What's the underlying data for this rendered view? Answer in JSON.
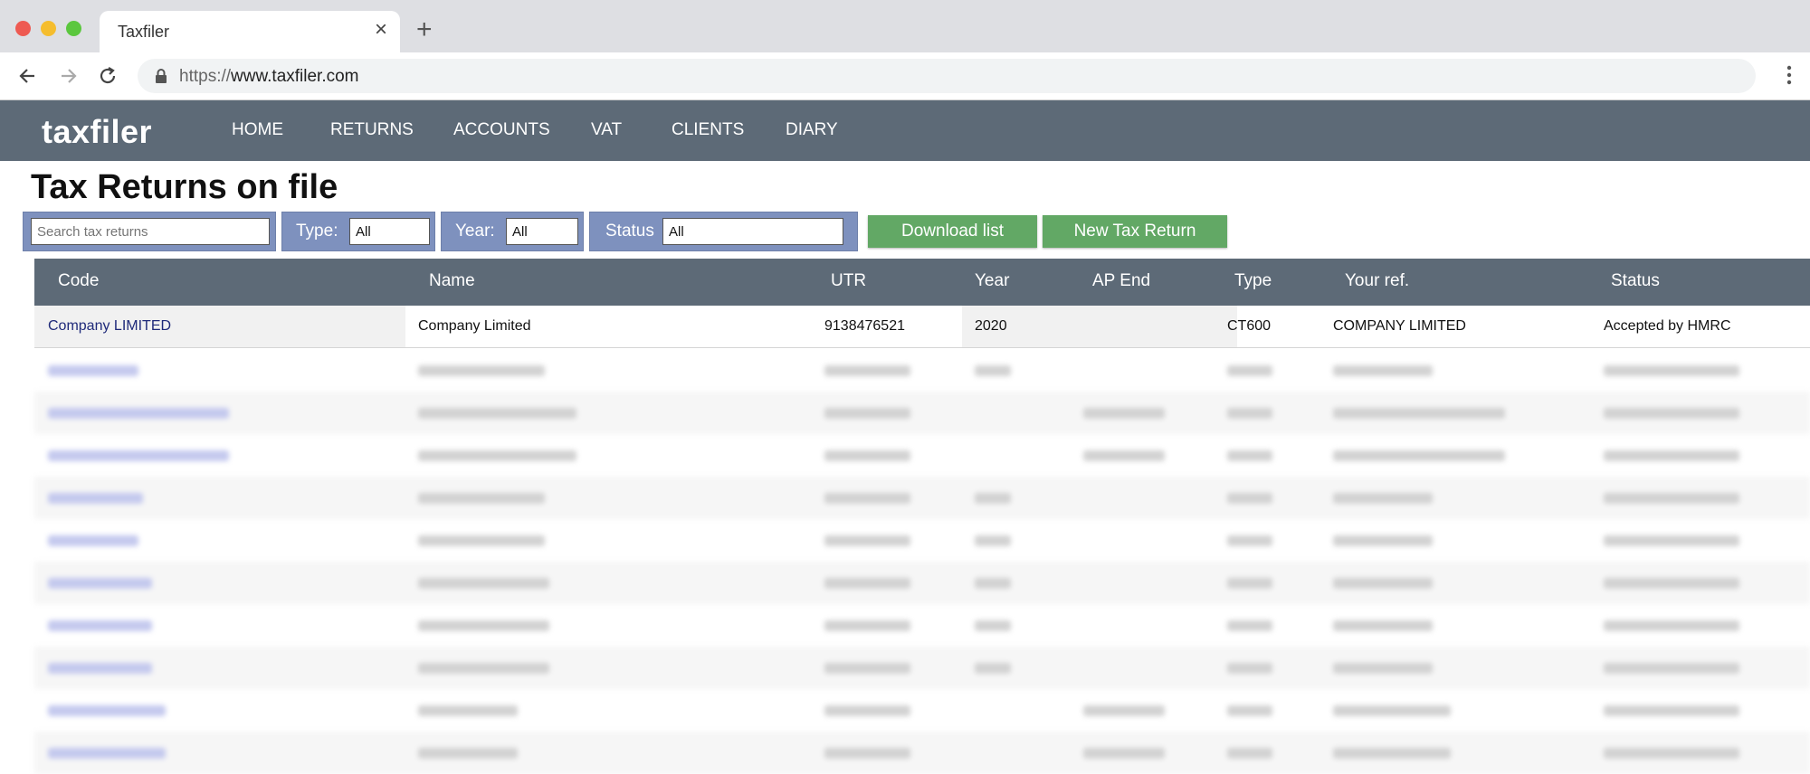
{
  "browser": {
    "tab_title": "Taxfiler",
    "url_protocol": "https://",
    "url_host": "www.taxfiler.com"
  },
  "app": {
    "logo": "taxfiler",
    "nav": [
      "HOME",
      "RETURNS",
      "ACCOUNTS",
      "VAT",
      "CLIENTS",
      "DIARY"
    ]
  },
  "page": {
    "title": "Tax Returns on file"
  },
  "filters": {
    "search_placeholder": "Search tax returns",
    "type_label": "Type:",
    "type_value": "All",
    "year_label": "Year:",
    "year_value": "All",
    "status_label": "Status",
    "status_value": "All"
  },
  "buttons": {
    "download": "Download list",
    "new_return": "New Tax Return"
  },
  "table": {
    "columns": [
      "Code",
      "Name",
      "UTR",
      "Year",
      "AP End",
      "Type",
      "Your ref.",
      "Status"
    ],
    "rows": [
      {
        "code": "Company LIMITED",
        "name": "Company Limited",
        "utr": "9138476521",
        "year": "2020",
        "ap_end": "",
        "type": "CT600",
        "ref": "COMPANY LIMITED",
        "status": "Accepted by HMRC"
      }
    ]
  },
  "colors": {
    "nav_bg": "#5d6a77",
    "filter_bg": "#7e91be",
    "button_green": "#62a865",
    "link": "#1f2a7a"
  }
}
